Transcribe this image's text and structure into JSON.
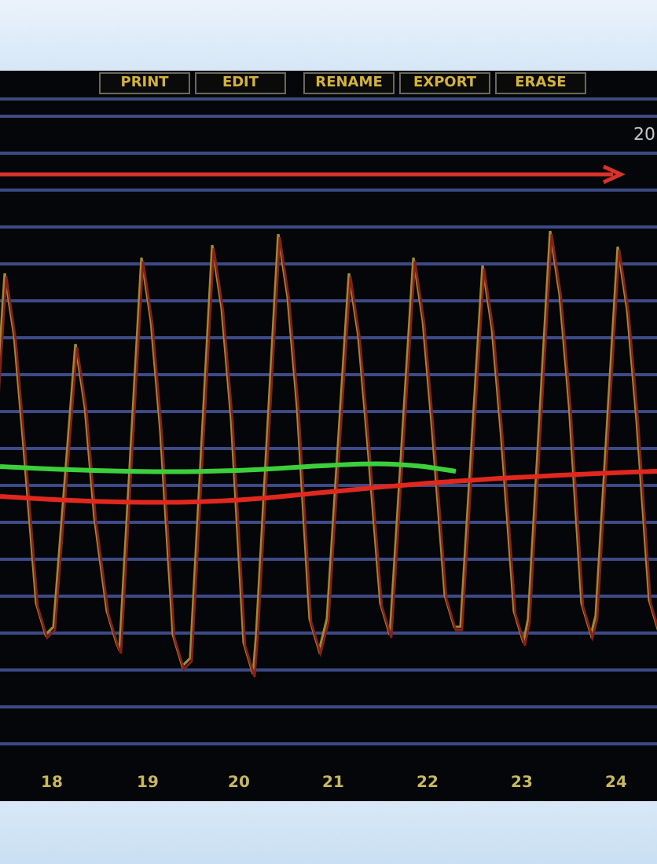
{
  "toolbar": {
    "buttons": [
      "PRINT",
      "EDIT",
      "RENAME",
      "EXPORT",
      "ERASE"
    ]
  },
  "corner_label": "20",
  "x_axis_labels": [
    "18",
    "19",
    "20",
    "21",
    "22",
    "23",
    "24"
  ]
}
